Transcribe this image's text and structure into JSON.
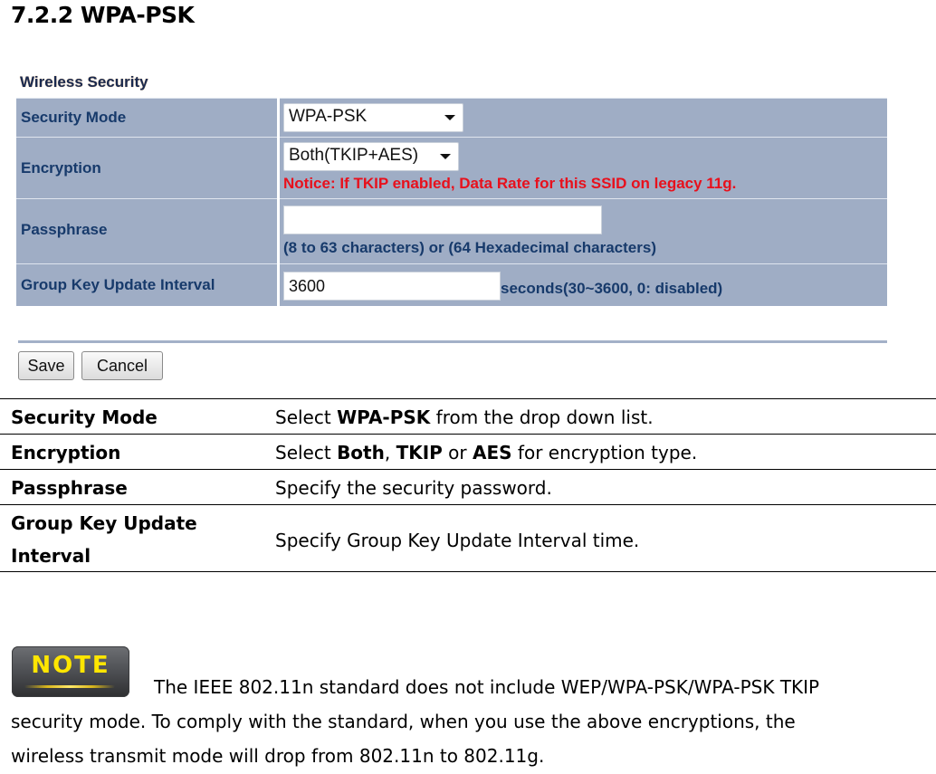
{
  "heading": "7.2.2 WPA-PSK",
  "panel": {
    "title": "Wireless Security",
    "rows": [
      {
        "label": "Security Mode",
        "select_value": "WPA-PSK"
      },
      {
        "label": "Encryption",
        "select_value": "Both(TKIP+AES)",
        "notice": "Notice: If TKIP enabled, Data Rate for this SSID on legacy 11g."
      },
      {
        "label": "Passphrase",
        "input_value": "",
        "hint": "(8 to 63 characters) or (64 Hexadecimal characters)"
      },
      {
        "label": "Group Key Update Interval",
        "input_value": "3600",
        "hint": "seconds(30~3600, 0: disabled)"
      }
    ],
    "colors": {
      "row_bg": "#9fadc5",
      "label_text": "#173a6b",
      "notice_text": "#e8101c"
    },
    "buttons": {
      "save": "Save",
      "cancel": "Cancel"
    }
  },
  "description": {
    "rows": [
      {
        "key": "Security Mode",
        "pre": "Select ",
        "b1": "WPA-PSK",
        "post": " from the drop down list."
      },
      {
        "key": "Encryption",
        "pre": "Select ",
        "b1": "Both",
        "mid1": ", ",
        "b2": "TKIP",
        "mid2": " or ",
        "b3": "AES",
        "post": " for encryption type."
      },
      {
        "key": "Passphrase",
        "text": "Specify the security password."
      },
      {
        "key_line1": "Group Key Update",
        "key_line2": "Interval",
        "text": "Specify Group Key Update Interval time."
      }
    ]
  },
  "note": {
    "badge": "NOTE",
    "line1": "The IEEE 802.11n standard does not include WEP/WPA-PSK/WPA-PSK TKIP",
    "line2": "security mode. To comply with the standard, when you use the above encryptions, the",
    "line3": "wireless transmit mode will drop from 802.11n to 802.11g."
  }
}
